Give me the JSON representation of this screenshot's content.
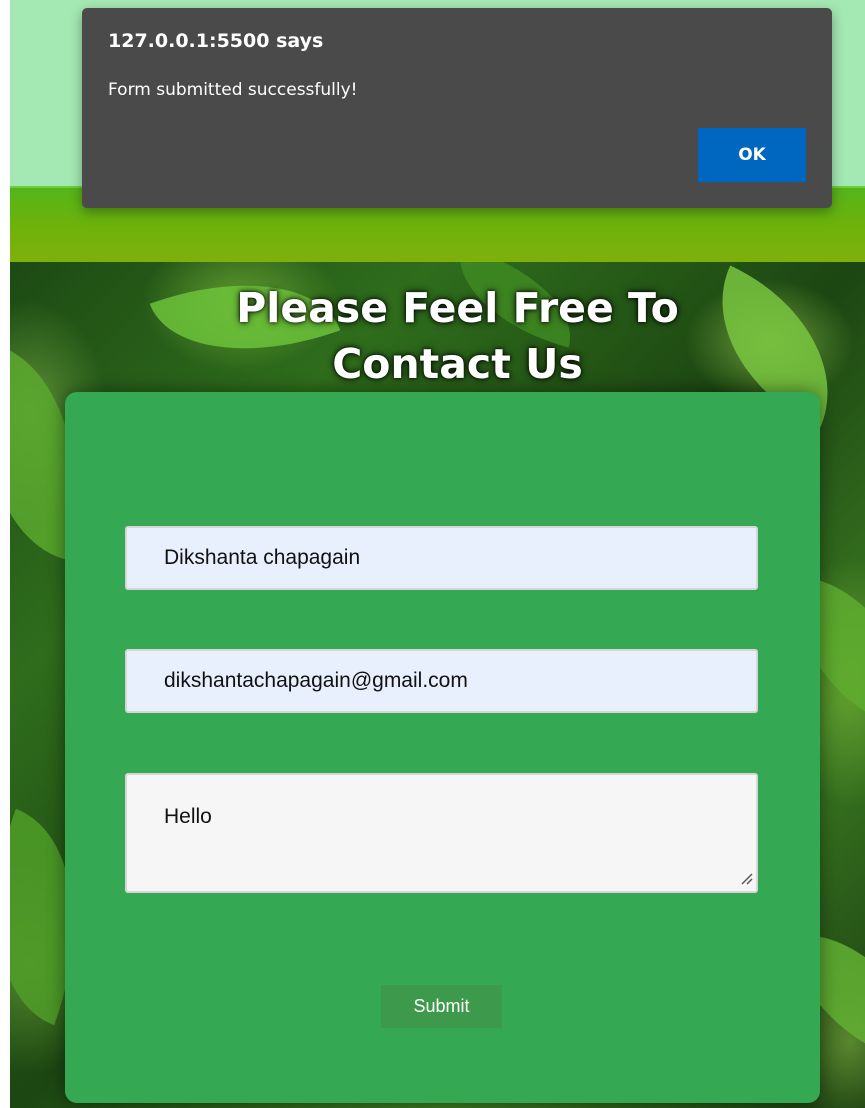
{
  "alert": {
    "title": "127.0.0.1:5500 says",
    "message": "Form submitted successfully!",
    "ok_label": "OK"
  },
  "hero": {
    "title": "Please Feel Free To\nContact Us"
  },
  "form": {
    "name_value": "Dikshanta chapagain",
    "email_value": "dikshantachapagain@gmail.com",
    "message_value": "Hello",
    "submit_label": "Submit"
  },
  "colors": {
    "nav_background": "#a4e8b4",
    "form_card": "#34a853",
    "submit_button": "#3d9a4c",
    "alert_background": "#4a4a4a",
    "alert_ok_button": "#0067c0"
  },
  "icons": {
    "resize_grip": "resize-grip-icon"
  }
}
